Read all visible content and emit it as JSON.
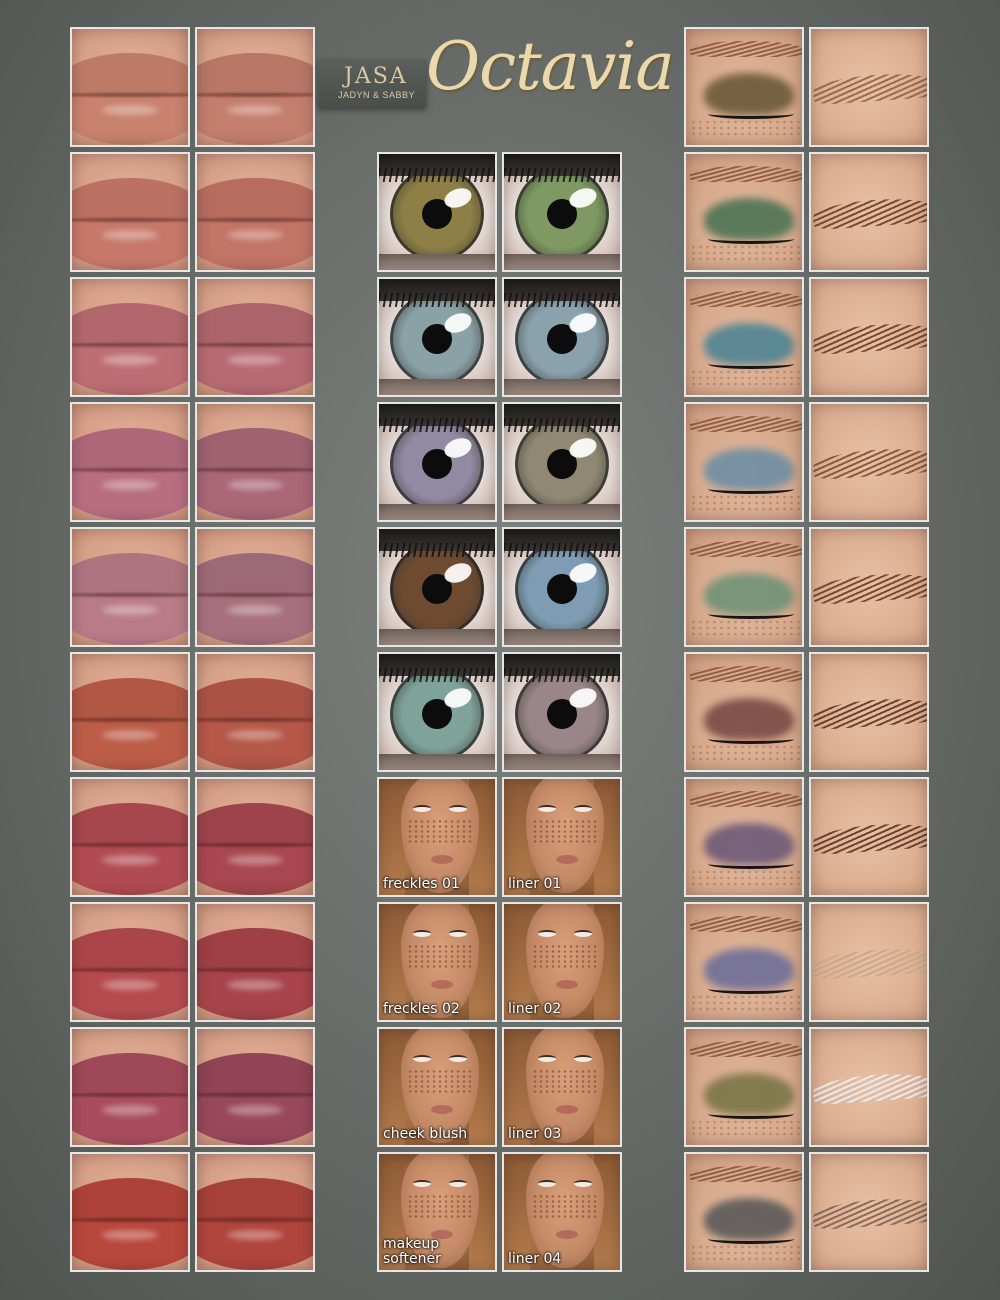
{
  "brand": {
    "logo_text": "JASA",
    "logo_subtitle": "JADYN & SABBY",
    "product_title": "Octavia"
  },
  "palette": {
    "lips": [
      [
        "#c9826e",
        "#c47e6d"
      ],
      [
        "#c7786a",
        "#c27466"
      ],
      [
        "#bd6e73",
        "#b76a72"
      ],
      [
        "#b86e80",
        "#aa6778"
      ],
      [
        "#b97b88",
        "#a8707e"
      ],
      [
        "#bc5d48",
        "#b55848"
      ],
      [
        "#b14b52",
        "#a8474f"
      ],
      [
        "#b54b4f",
        "#a8444b"
      ],
      [
        "#a94d5e",
        "#99485c"
      ],
      [
        "#b8473c",
        "#b0453c"
      ]
    ],
    "irises": [
      [
        "#8e7f46",
        "#7e9a62"
      ],
      [
        "#8aa1a6",
        "#8aa2ad"
      ],
      [
        "#9289a3",
        "#918873"
      ],
      [
        "#6e4a31",
        "#7e9db5"
      ],
      [
        "#7fa39a",
        "#9a8588"
      ]
    ],
    "eyeshadows": [
      "#6b5a3a",
      "#4d7453",
      "#4d8494",
      "#6e8ea4",
      "#6f9277",
      "#7a4a45",
      "#6e5a78",
      "#6f6f98",
      "#7a7646",
      "#5b5a5a"
    ],
    "brows": [
      "#9a6b4c",
      "#7a4a34",
      "#7a4a34",
      "#8a5a3e",
      "#7a4a34",
      "#6e4230",
      "#6e4230",
      "#c9a98a",
      "#e6ebf0",
      "#8a6a58"
    ]
  },
  "face_labels": {
    "freckles_01": "freckles 01",
    "liner_01": "liner 01",
    "freckles_02": "freckles 02",
    "liner_02": "liner 02",
    "cheek_blush": "cheek blush",
    "liner_03": "liner 03",
    "makeup_softener": "makeup\nsoftener",
    "liner_04": "liner 04"
  }
}
